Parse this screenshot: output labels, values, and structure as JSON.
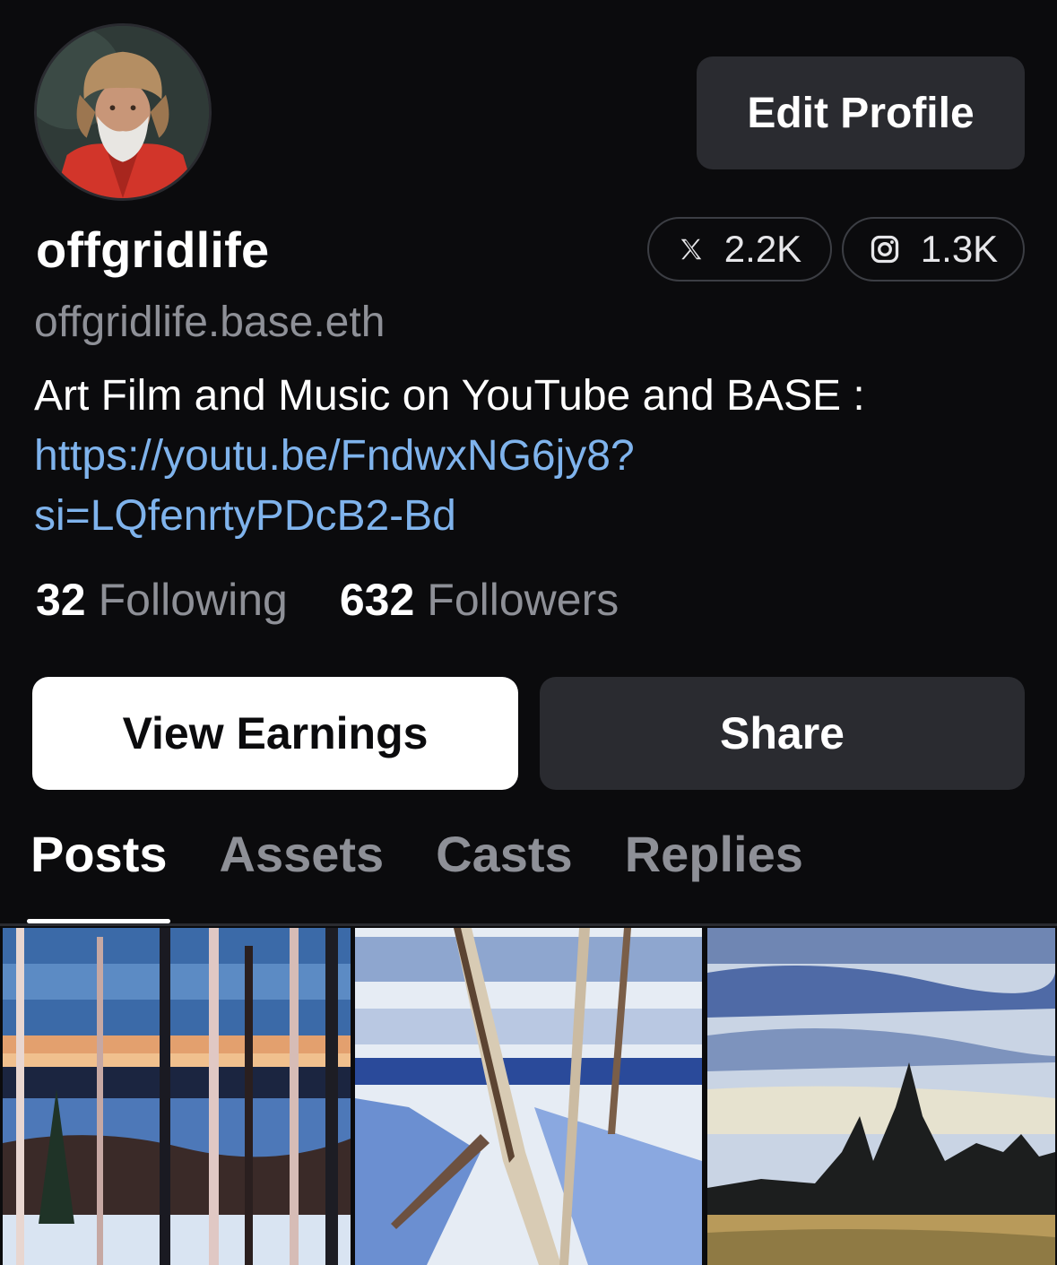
{
  "profile": {
    "avatar_alt": "avatar",
    "username": "offgridlife",
    "handle": "offgridlife.base.eth",
    "bio_text": "Art Film and Music on YouTube and BASE :",
    "bio_link_line1": "https://youtu.be/FndwxNG6jy8?",
    "bio_link_line2": "si=LQfenrtyPDcB2-Bd"
  },
  "header": {
    "edit_profile_label": "Edit Profile"
  },
  "social": {
    "x_icon": "x-logo-icon",
    "x_count": "2.2K",
    "instagram_icon": "instagram-icon",
    "instagram_count": "1.3K"
  },
  "stats": {
    "following_count": "32",
    "following_label": "Following",
    "followers_count": "632",
    "followers_label": "Followers"
  },
  "actions": {
    "view_earnings_label": "View Earnings",
    "share_label": "Share"
  },
  "tabs": [
    {
      "label": "Posts",
      "active": true
    },
    {
      "label": "Assets",
      "active": false
    },
    {
      "label": "Casts",
      "active": false
    },
    {
      "label": "Replies",
      "active": false
    }
  ],
  "colors": {
    "background": "#0b0b0d",
    "surface": "#2a2b30",
    "muted_text": "#8e9097",
    "link": "#7fb3ec"
  }
}
